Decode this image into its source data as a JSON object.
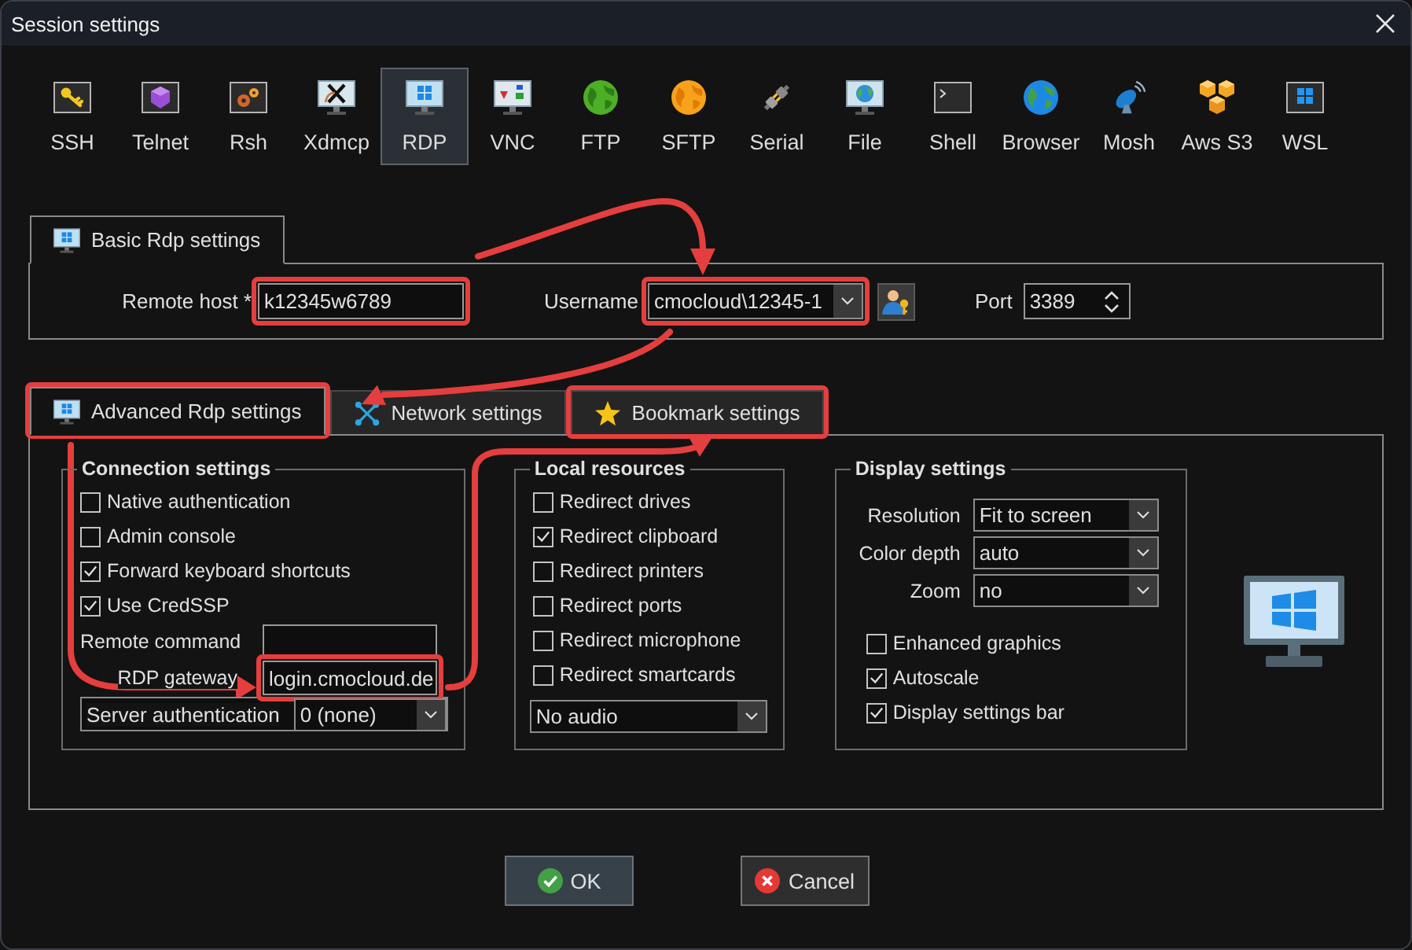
{
  "window": {
    "title": "Session settings"
  },
  "session_types": [
    {
      "label": "SSH",
      "selected": false
    },
    {
      "label": "Telnet",
      "selected": false
    },
    {
      "label": "Rsh",
      "selected": false
    },
    {
      "label": "Xdmcp",
      "selected": false
    },
    {
      "label": "RDP",
      "selected": true
    },
    {
      "label": "VNC",
      "selected": false
    },
    {
      "label": "FTP",
      "selected": false
    },
    {
      "label": "SFTP",
      "selected": false
    },
    {
      "label": "Serial",
      "selected": false
    },
    {
      "label": "File",
      "selected": false
    },
    {
      "label": "Shell",
      "selected": false
    },
    {
      "label": "Browser",
      "selected": false
    },
    {
      "label": "Mosh",
      "selected": false
    },
    {
      "label": "Aws S3",
      "selected": false
    },
    {
      "label": "WSL",
      "selected": false
    }
  ],
  "basic_tab": {
    "label": "Basic Rdp settings",
    "selected": true
  },
  "basic": {
    "remote_host": {
      "label": "Remote host *",
      "value": "k12345w6789",
      "highlighted": true
    },
    "username": {
      "label": "Username",
      "value": "cmocloud\\12345-1",
      "highlighted": true
    },
    "port": {
      "label": "Port",
      "value": "3389",
      "highlighted": false
    }
  },
  "tabs": [
    {
      "label": "Advanced Rdp settings",
      "selected": true,
      "highlighted": true
    },
    {
      "label": "Network settings",
      "selected": false,
      "highlighted": false
    },
    {
      "label": "Bookmark settings",
      "selected": false,
      "highlighted": true
    }
  ],
  "connection_settings": {
    "title": "Connection settings",
    "options": [
      {
        "label": "Native authentication",
        "checked": false
      },
      {
        "label": "Admin console",
        "checked": false
      },
      {
        "label": "Forward keyboard shortcuts",
        "checked": true
      },
      {
        "label": "Use CredSSP",
        "checked": true
      }
    ],
    "fields": [
      {
        "kind": "input",
        "label": "Remote command",
        "highlighted": false
      },
      {
        "kind": "input",
        "label": "RDP gateway",
        "value": "login.cmocloud.de",
        "highlighted": true
      },
      {
        "kind": "select",
        "label": "Server authentication",
        "value": "0 (none)",
        "highlighted": false
      }
    ]
  },
  "local_resources": {
    "title": "Local resources",
    "options": [
      {
        "label": "Redirect drives",
        "checked": false
      },
      {
        "label": "Redirect clipboard",
        "checked": true
      },
      {
        "label": "Redirect printers",
        "checked": false
      },
      {
        "label": "Redirect ports",
        "checked": false
      },
      {
        "label": "Redirect microphone",
        "checked": false
      },
      {
        "label": "Redirect smartcards",
        "checked": false
      }
    ],
    "audio": {
      "value": "No audio"
    }
  },
  "display_settings": {
    "title": "Display settings",
    "fields": [
      {
        "label": "Resolution",
        "value": "Fit to screen"
      },
      {
        "label": "Color depth",
        "value": "auto"
      },
      {
        "label": "Zoom",
        "value": "no"
      }
    ],
    "options": [
      {
        "label": "Enhanced graphics",
        "checked": false
      },
      {
        "label": "Autoscale",
        "checked": true
      },
      {
        "label": "Display settings bar",
        "checked": true
      }
    ]
  },
  "buttons": [
    {
      "kind": "ok",
      "label": "OK"
    },
    {
      "kind": "cancel",
      "label": "Cancel"
    }
  ]
}
